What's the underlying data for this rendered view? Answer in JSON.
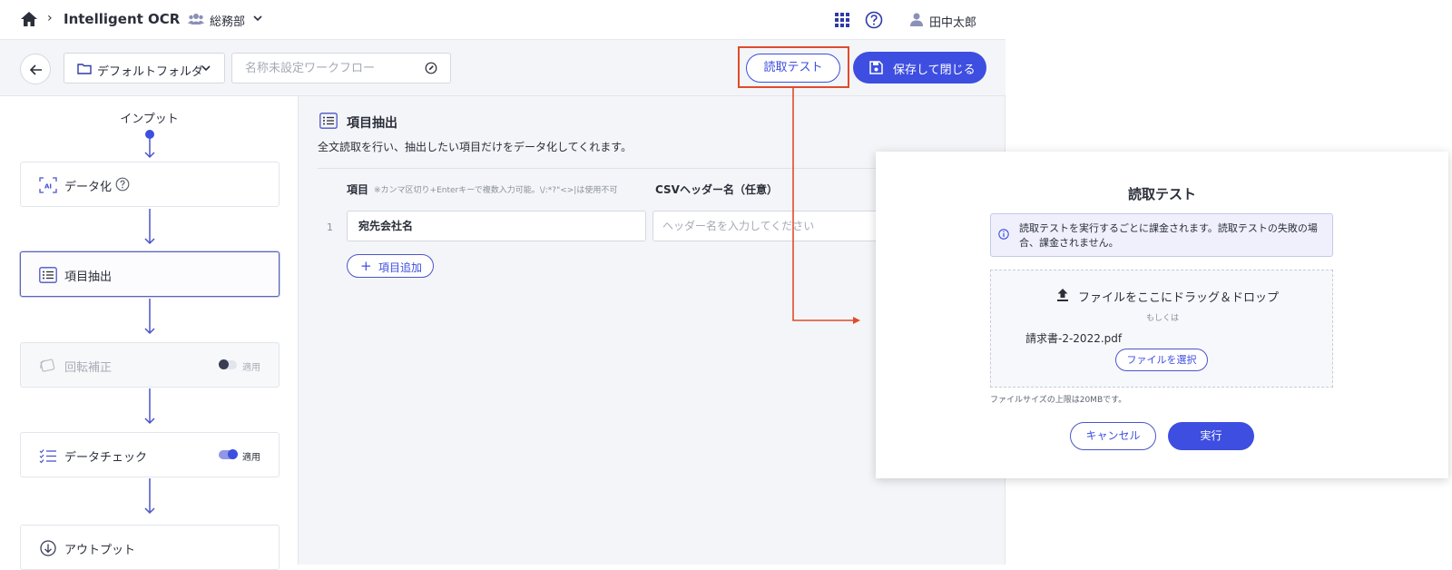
{
  "header": {
    "app_title": "Intelligent OCR",
    "team_name": "総務部",
    "user_name": "田中太郎"
  },
  "toolbar": {
    "folder_label": "デフォルトフォルダ",
    "workflow_name_value": "",
    "workflow_name_placeholder": "名称未設定ワークフロー",
    "test_button_label": "読取テスト",
    "save_button_label": "保存して閉じる"
  },
  "flow": {
    "input_label": "インプット",
    "steps": [
      {
        "label": "データ化",
        "icon": "ai-icon",
        "has_help": true,
        "active": false,
        "disabled": false
      },
      {
        "label": "項目抽出",
        "icon": "list-icon",
        "active": true,
        "disabled": false
      },
      {
        "label": "回転補正",
        "icon": "rotate-icon",
        "active": false,
        "disabled": true,
        "toggle_label": "適用",
        "toggle_on": false
      },
      {
        "label": "データチェック",
        "icon": "checklist-icon",
        "active": false,
        "disabled": false,
        "toggle_label": "適用",
        "toggle_on": true
      },
      {
        "label": "アウトプット",
        "icon": "download-circle-icon",
        "active": false,
        "disabled": false
      }
    ]
  },
  "section": {
    "title": "項目抽出",
    "description": "全文読取を行い、抽出したい項目だけをデータ化してくれます。",
    "col_item": "項目",
    "col_item_note": "※カンマ区切り+Enterキーで複数入力可能。\\/:*?\"<>|は使用不可",
    "col_csv": "CSVヘッダー名（任意）",
    "rows": [
      {
        "num": "1",
        "item_value": "宛先会社名",
        "csv_placeholder": "ヘッダー名を入力してください"
      }
    ],
    "add_button_label": "項目追加"
  },
  "modal": {
    "title": "読取テスト",
    "info_text": "読取テストを実行するごとに課金されます。読取テストの失敗の場合、課金されません。",
    "drop_text": "ファイルをここにドラッグ＆ドロップ",
    "or_text": "もしくは",
    "file_name": "請求書-2-2022.pdf",
    "select_button_label": "ファイルを選択",
    "size_limit": "ファイルサイズの上限は20MBです。",
    "cancel_label": "キャンセル",
    "run_label": "実行"
  },
  "colors": {
    "accent": "#3d4ee0",
    "highlight": "#e04b2c",
    "flow_arrow": "#4a55c8"
  }
}
